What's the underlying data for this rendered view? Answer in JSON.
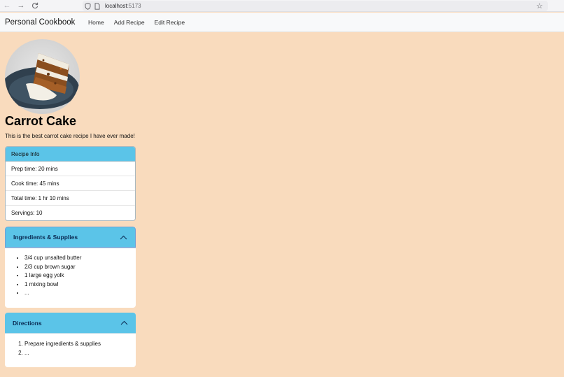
{
  "browser": {
    "url_host": "localhost",
    "url_port": ":5173"
  },
  "navbar": {
    "brand": "Personal Cookbook",
    "links": [
      "Home",
      "Add Recipe",
      "Edit Recipe"
    ]
  },
  "recipe": {
    "title": "Carrot Cake",
    "description": "This is the best carrot cake recipe I have ever made!",
    "image_icon": "carrot-cake-photo"
  },
  "info": {
    "header": "Recipe Info",
    "rows": [
      "Prep time: 20 mins",
      "Cook time: 45 mins",
      "Total time: 1 hr 10 mins",
      "Servings: 10"
    ]
  },
  "ingredients": {
    "title": "Ingredients & Supplies",
    "items": [
      "3/4 cup unsalted butter",
      "2/3 cup brown sugar",
      "1 large egg yolk",
      "1 mixing bowl",
      "..."
    ]
  },
  "directions": {
    "title": "Directions",
    "items": [
      "Prepare ingredients & supplies",
      "..."
    ]
  },
  "colors": {
    "page_bg": "#f9dbbd",
    "accent": "#5bc4e8",
    "accordion_title": "#0a2a52"
  }
}
